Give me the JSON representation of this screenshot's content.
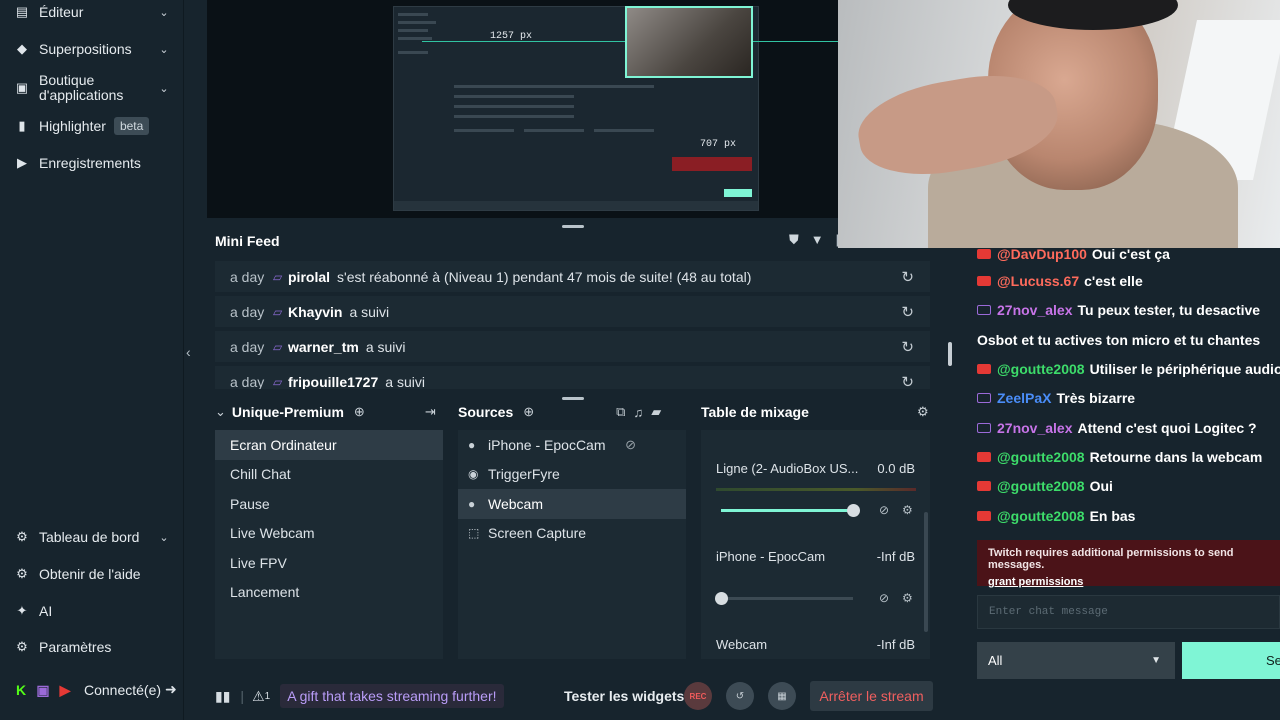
{
  "sidebar": {
    "items": [
      {
        "label": "Éditeur",
        "icon": "editor-icon",
        "chev": "⌄"
      },
      {
        "label": "Superpositions",
        "icon": "overlays-icon",
        "chev": "⌄"
      },
      {
        "label": "Boutique d'applications",
        "icon": "store-icon",
        "chev": "⌄"
      },
      {
        "label": "Highlighter",
        "icon": "highlighter-icon",
        "badge": "beta"
      },
      {
        "label": "Enregistrements",
        "icon": "recordings-icon"
      }
    ],
    "bottom": [
      {
        "label": "Tableau de bord",
        "icon": "dashboard-icon",
        "chev": "⌄"
      },
      {
        "label": "Obtenir de l'aide",
        "icon": "help-icon"
      },
      {
        "label": "AI",
        "icon": "ai-sparkle-icon"
      },
      {
        "label": "Paramètres",
        "icon": "settings-icon"
      }
    ],
    "connected": "Connecté(e)"
  },
  "preview": {
    "width_label": "1257 px",
    "height_label": "707 px"
  },
  "mini_feed": {
    "title": "Mini Feed",
    "rows": [
      {
        "time": "a day",
        "user": "pirolal",
        "message": "s'est réabonné à (Niveau 1) pendant 47 mois de suite! (48 au total)"
      },
      {
        "time": "a day",
        "user": "Khayvin",
        "message": "a suivi"
      },
      {
        "time": "a day",
        "user": "warner_tm",
        "message": "a suivi"
      },
      {
        "time": "a day",
        "user": "fripouille1727",
        "message": "a suivi"
      }
    ]
  },
  "scenes": {
    "collection": "Unique-Premium",
    "items": [
      "Ecran Ordinateur",
      "Chill Chat",
      "Pause",
      "Live Webcam",
      "Live FPV",
      "Lancement"
    ],
    "active_index": 0
  },
  "sources": {
    "title": "Sources",
    "items": [
      "iPhone - EpocCam",
      "TriggerFyre",
      "Webcam",
      "Screen Capture"
    ],
    "active_index": 2
  },
  "mixer": {
    "title": "Table de mixage",
    "channels": [
      {
        "name": "Ligne (2- AudioBox US...",
        "db": "0.0 dB",
        "volume": 1.0
      },
      {
        "name": "iPhone - EpocCam",
        "db": "-Inf dB",
        "volume": 0.0
      },
      {
        "name": "Webcam",
        "db": "-Inf dB",
        "volume": 0.0
      }
    ]
  },
  "footer": {
    "alert_count": "1",
    "gift": "A gift that takes streaming further!",
    "test_widgets": "Tester les widgets",
    "rec": "REC",
    "stop_stream": "Arrêter le stream"
  },
  "chat": {
    "messages": [
      {
        "platform": "youtube",
        "user": "@DavDup100",
        "user_color": "#ff6b5c",
        "message": "Oui c'est ça"
      },
      {
        "platform": "youtube",
        "user": "@Lucuss.67",
        "user_color": "#ff6b5c",
        "message": "c'est elle"
      },
      {
        "platform": "twitch",
        "user": "27nov_alex",
        "user_color": "#c774e8",
        "message": "Tu peux tester, tu desactive"
      },
      {
        "platform": "none",
        "user": "",
        "user_color": "#ffffff",
        "message": "Osbot et tu actives ton micro et tu chantes"
      },
      {
        "platform": "youtube",
        "user": "@goutte2008",
        "user_color": "#3ddc6a",
        "message": "Utiliser le périphérique audio"
      },
      {
        "platform": "twitch",
        "user": "ZeelPaX",
        "user_color": "#4a8df8",
        "message": "Très bizarre"
      },
      {
        "platform": "twitch",
        "user": "27nov_alex",
        "user_color": "#c774e8",
        "message": "Attend c'est quoi Logitec ?"
      },
      {
        "platform": "youtube",
        "user": "@goutte2008",
        "user_color": "#3ddc6a",
        "message": "Retourne dans la webcam"
      },
      {
        "platform": "youtube",
        "user": "@goutte2008",
        "user_color": "#3ddc6a",
        "message": "Oui"
      },
      {
        "platform": "youtube",
        "user": "@goutte2008",
        "user_color": "#3ddc6a",
        "message": "En bas"
      }
    ],
    "permission_text": "Twitch requires additional permissions to send messages.",
    "permission_link": "grant permissions",
    "input_placeholder": "Enter chat message",
    "platform_select": "All",
    "send": "Se"
  },
  "colors": {
    "accent": "#7ff5d5",
    "danger": "#f05f5f",
    "background": "#17242d",
    "panel": "#1c2a33"
  }
}
